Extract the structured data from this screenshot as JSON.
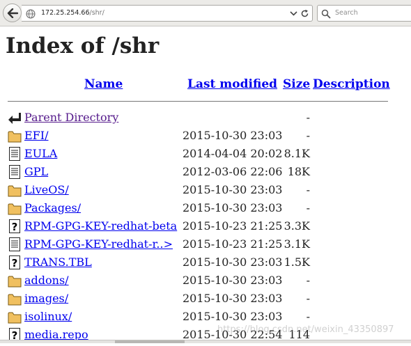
{
  "toolbar": {
    "url_host": "172.25.254.66",
    "url_path": "/shr/",
    "search_placeholder": "Search"
  },
  "page": {
    "title": "Index of /shr"
  },
  "columns": {
    "name": "Name",
    "last_modified": "Last modified",
    "size": "Size",
    "description": "Description"
  },
  "rows": [
    {
      "icon": "parent-arrow",
      "name": "Parent Directory",
      "date": "",
      "size": "-"
    },
    {
      "icon": "folder",
      "name": "EFI/",
      "date": "2015-10-30 23:03",
      "size": "-"
    },
    {
      "icon": "text-file",
      "name": "EULA",
      "date": "2014-04-04 20:02",
      "size": "8.1K"
    },
    {
      "icon": "text-file",
      "name": "GPL",
      "date": "2012-03-06 22:06",
      "size": "18K"
    },
    {
      "icon": "folder",
      "name": "LiveOS/",
      "date": "2015-10-30 23:03",
      "size": "-"
    },
    {
      "icon": "folder",
      "name": "Packages/",
      "date": "2015-10-30 23:03",
      "size": "-"
    },
    {
      "icon": "unknown-file",
      "name": "RPM-GPG-KEY-redhat-beta",
      "date": "2015-10-23 21:25",
      "size": "3.3K"
    },
    {
      "icon": "text-file",
      "name": "RPM-GPG-KEY-redhat-r..>",
      "date": "2015-10-23 21:25",
      "size": "3.1K"
    },
    {
      "icon": "unknown-file",
      "name": "TRANS.TBL",
      "date": "2015-10-30 23:03",
      "size": "1.5K"
    },
    {
      "icon": "folder",
      "name": "addons/",
      "date": "2015-10-30 23:03",
      "size": "-"
    },
    {
      "icon": "folder",
      "name": "images/",
      "date": "2015-10-30 23:03",
      "size": "-"
    },
    {
      "icon": "folder",
      "name": "isolinux/",
      "date": "2015-10-30 23:03",
      "size": "-"
    },
    {
      "icon": "unknown-file",
      "name": "media.repo",
      "date": "2015-10-30 22:54",
      "size": "114"
    }
  ],
  "watermark": "https://blog.csdn.net/weixin_43350897",
  "colors": {
    "link": "#0000ee",
    "visited": "#551a8b",
    "folder": "#f0c060",
    "toolbar_bg": "#ecebe8"
  }
}
